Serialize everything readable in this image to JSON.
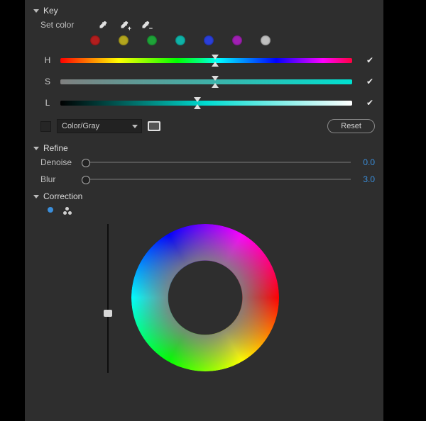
{
  "key": {
    "title": "Key",
    "set_color_label": "Set color",
    "swatch_colors": [
      "#b31e1e",
      "#b3a61e",
      "#1ea338",
      "#0fb3a8",
      "#2a3fd9",
      "#a020b3",
      "#c0c0c0"
    ],
    "hsl": {
      "h": {
        "label": "H",
        "position_pct": 53,
        "checked": true
      },
      "s": {
        "label": "S",
        "position_pct": 53,
        "checked": true
      },
      "l": {
        "label": "L",
        "position_pct": 47,
        "checked": true
      }
    },
    "colorgray": {
      "checked": false,
      "option": "Color/Gray"
    },
    "reset_label": "Reset"
  },
  "refine": {
    "title": "Refine",
    "denoise": {
      "label": "Denoise",
      "value": "0.0",
      "position_pct": 0
    },
    "blur": {
      "label": "Blur",
      "value": "3.0",
      "position_pct": 0
    }
  },
  "correction": {
    "title": "Correction",
    "value_slider_pct": 60
  }
}
